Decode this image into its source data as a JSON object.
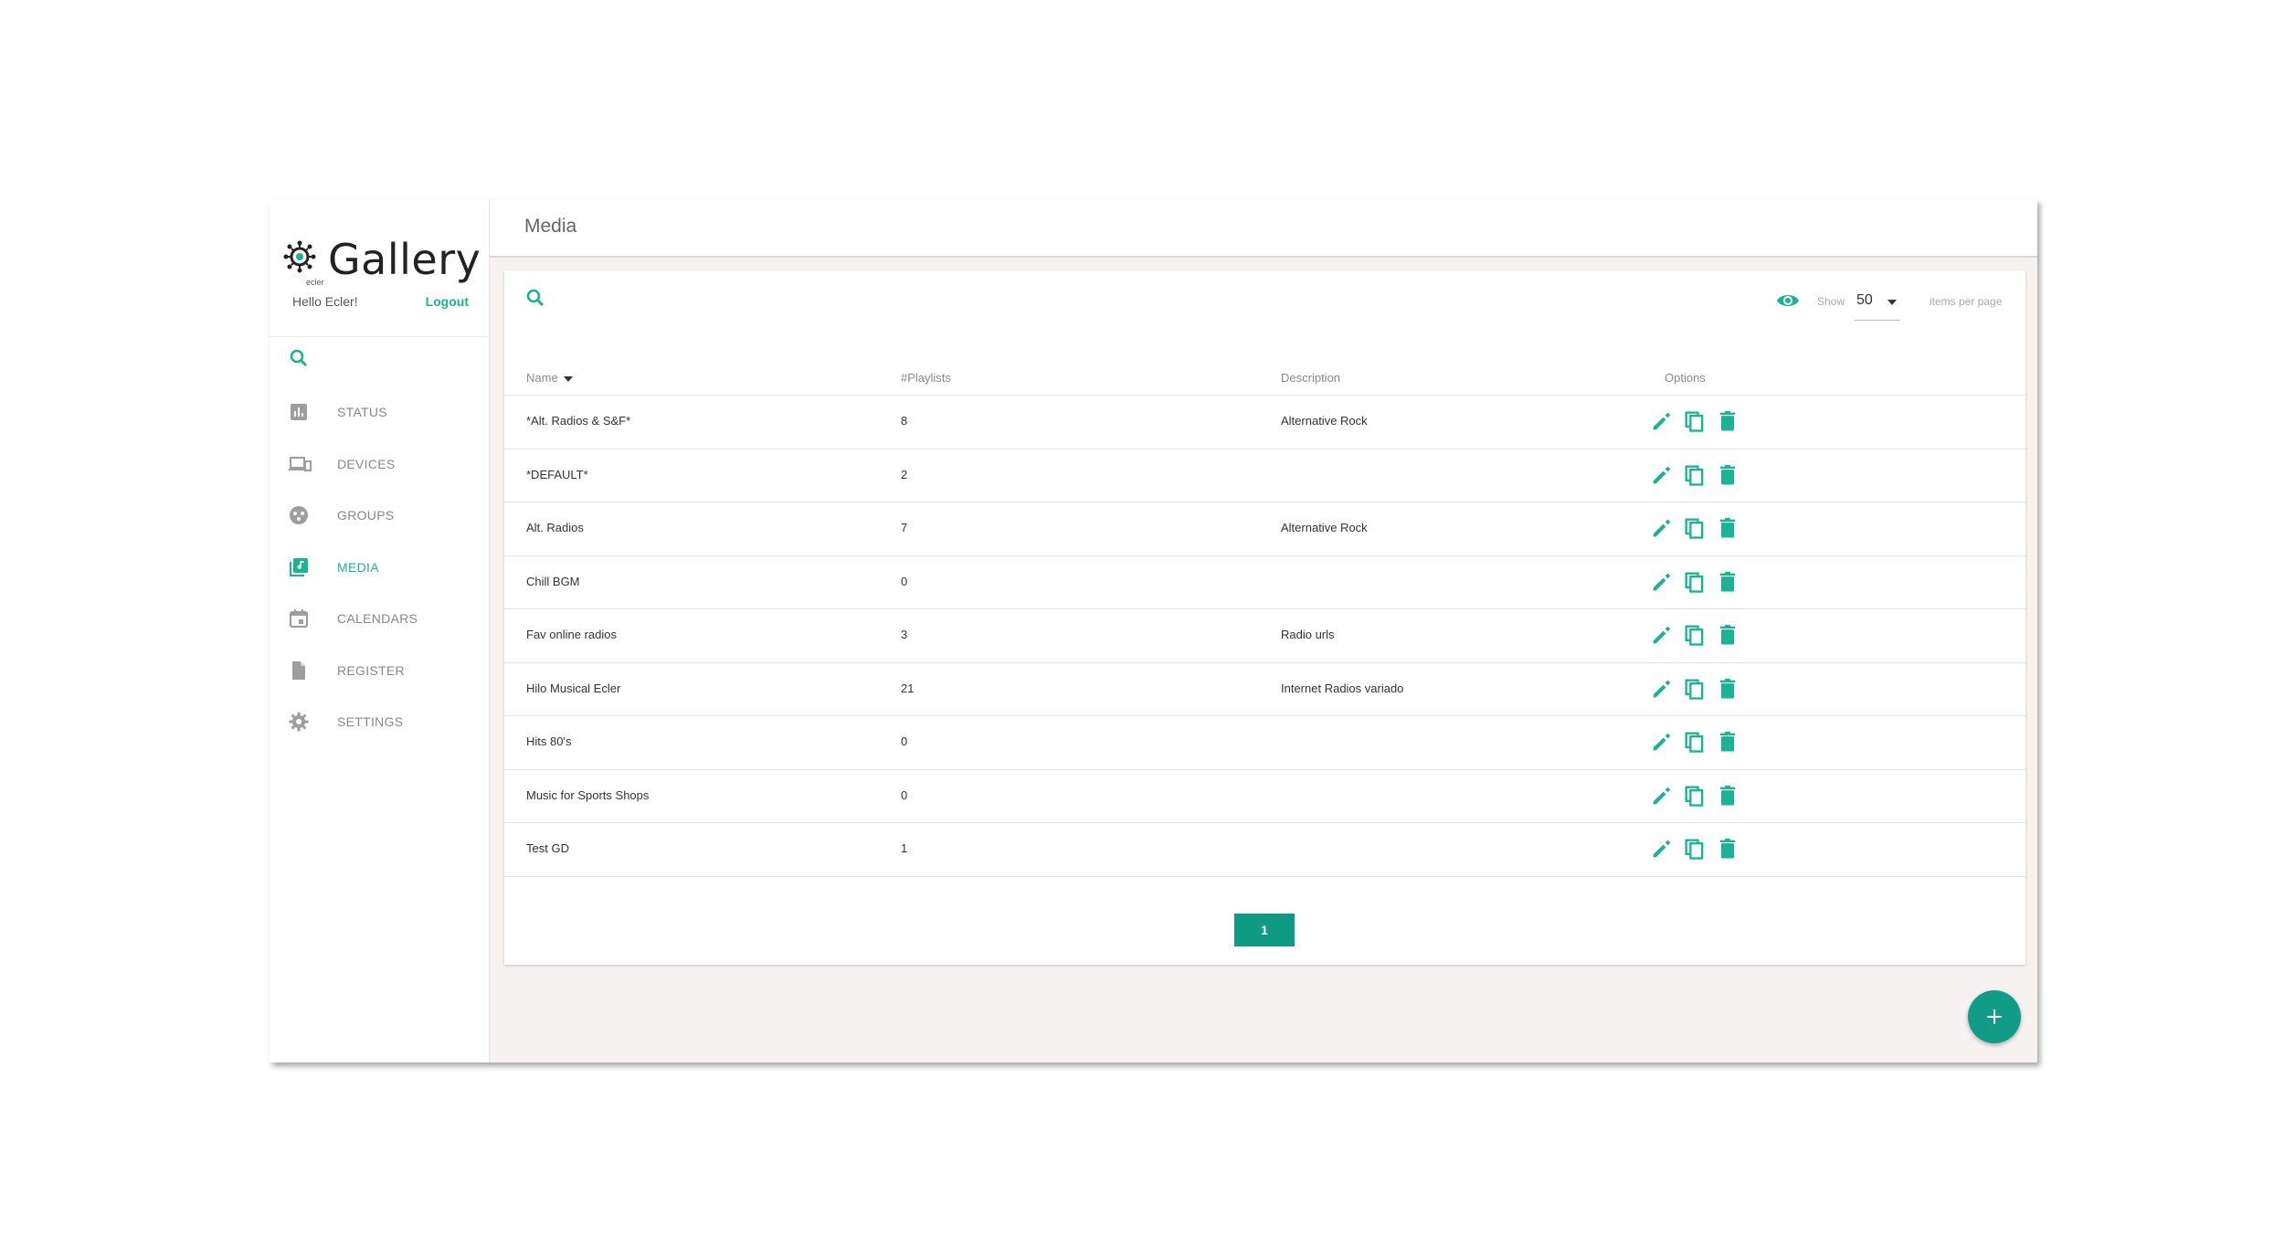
{
  "sidebar": {
    "logo": {
      "word": "Gallery",
      "sub": "ecler"
    },
    "greeting": "Hello Ecler!",
    "logout_label": "Logout",
    "items": [
      {
        "label": "STATUS",
        "icon": "bar-chart-icon",
        "active": false
      },
      {
        "label": "DEVICES",
        "icon": "devices-icon",
        "active": false
      },
      {
        "label": "GROUPS",
        "icon": "groups-icon",
        "active": false
      },
      {
        "label": "MEDIA",
        "icon": "media-library-icon",
        "active": true
      },
      {
        "label": "CALENDARS",
        "icon": "calendar-icon",
        "active": false
      },
      {
        "label": "REGISTER",
        "icon": "document-icon",
        "active": false
      },
      {
        "label": "SETTINGS",
        "icon": "gear-icon",
        "active": false
      }
    ]
  },
  "header": {
    "title": "Media"
  },
  "toolbar": {
    "show_label": "Show",
    "per_page_value": "50",
    "items_per_page_label": "items per page"
  },
  "table": {
    "columns": [
      "Name",
      "#Playlists",
      "Description",
      "Options"
    ],
    "rows": [
      {
        "name": "*Alt. Radios & S&F*",
        "playlists": "8",
        "description": "Alternative Rock"
      },
      {
        "name": "*DEFAULT*",
        "playlists": "2",
        "description": ""
      },
      {
        "name": "Alt. Radios",
        "playlists": "7",
        "description": "Alternative Rock"
      },
      {
        "name": "Chill BGM",
        "playlists": "0",
        "description": ""
      },
      {
        "name": "Fav online radios",
        "playlists": "3",
        "description": "Radio urls"
      },
      {
        "name": "Hilo Musical Ecler",
        "playlists": "21",
        "description": "Internet Radios variado"
      },
      {
        "name": "Hits 80's",
        "playlists": "0",
        "description": ""
      },
      {
        "name": "Music for Sports Shops",
        "playlists": "0",
        "description": ""
      },
      {
        "name": "Test GD",
        "playlists": "1",
        "description": ""
      }
    ]
  },
  "pagination": {
    "current": "1"
  },
  "fab": {
    "label": "+"
  },
  "colors": {
    "accent": "#1ab394",
    "accent_dark": "#0e9a85",
    "sidebar_icon": "#9e9e9e"
  }
}
